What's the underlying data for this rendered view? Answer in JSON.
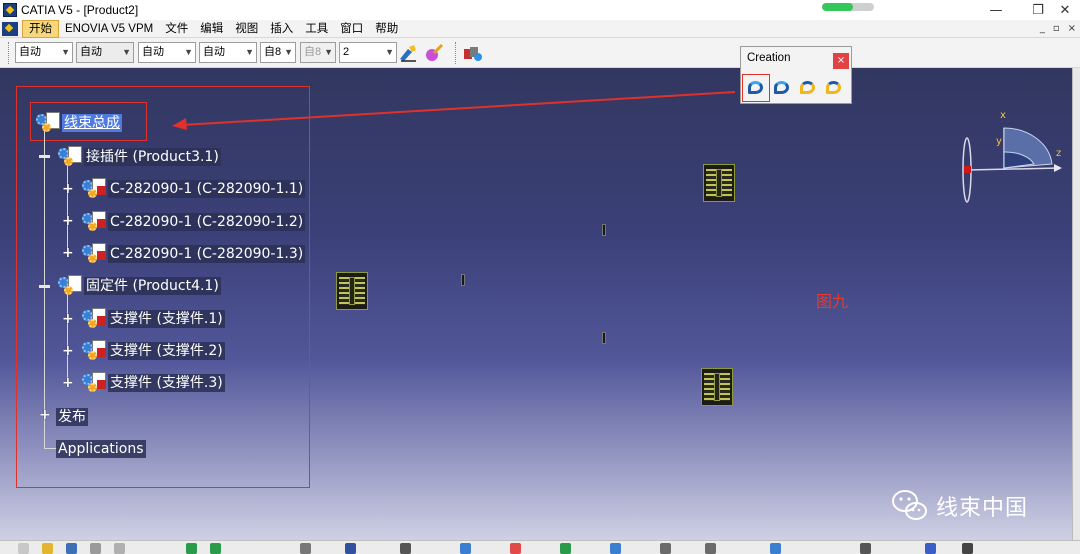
{
  "window": {
    "title": "CATIA V5 - [Product2]",
    "minimize": "—",
    "maximize": "❐",
    "close": "✕"
  },
  "menubar": {
    "items": [
      "开始",
      "ENOVIA V5 VPM",
      "文件",
      "编辑",
      "视图",
      "插入",
      "工具",
      "窗口",
      "帮助"
    ],
    "mdi_min": "_",
    "mdi_restore": "▫",
    "mdi_close": "×"
  },
  "toolbar": {
    "combos": [
      "自动",
      "自动",
      "自动",
      "自动",
      "自8",
      "自8",
      "2"
    ],
    "combo_states": [
      "enabled",
      "enabled",
      "enabled",
      "enabled",
      "enabled",
      "disabled",
      "enabled"
    ]
  },
  "tree": {
    "root": "线束总成",
    "connectors": {
      "label": "接插件 (Product3.1)",
      "children": [
        "C-282090-1 (C-282090-1.1)",
        "C-282090-1 (C-282090-1.2)",
        "C-282090-1 (C-282090-1.3)"
      ]
    },
    "fixtures": {
      "label": "固定件 (Product4.1)",
      "children": [
        "支撑件 (支撑件.1)",
        "支撑件 (支撑件.2)",
        "支撑件 (支撑件.3)"
      ]
    },
    "publish": "发布",
    "applications": "Applications"
  },
  "creation_palette": {
    "title": "Creation",
    "close": "×",
    "icons": [
      "bundle-segment-icon",
      "protective-covering-icon",
      "multi-branchable-icon",
      "support-icon"
    ]
  },
  "compass": {
    "x": "x",
    "y": "y",
    "z": "z"
  },
  "annotation": {
    "figure_label": "图九"
  },
  "watermark": {
    "text": "线束中国"
  },
  "colors": {
    "highlight_red": "#e0312b",
    "selection_blue": "#4f7be0",
    "viewport_top": "#323760",
    "viewport_bottom": "#cfd0e4"
  }
}
